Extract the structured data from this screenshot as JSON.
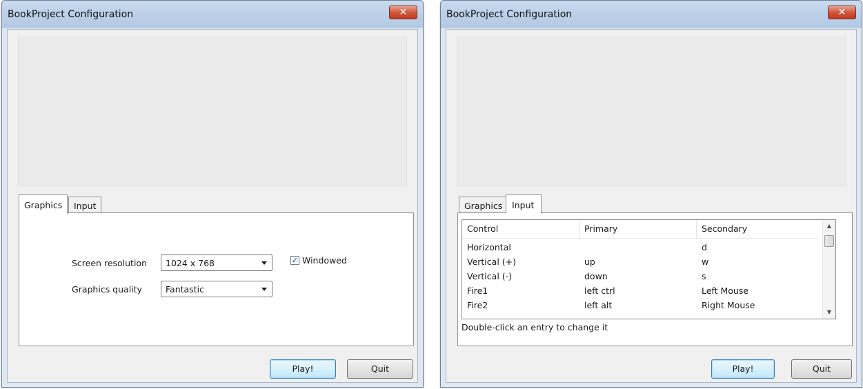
{
  "left_window": {
    "title": "BookProject Configuration",
    "close_glyph": "✕",
    "tabs": [
      "Graphics",
      "Input"
    ],
    "active_tab": "Graphics",
    "screen_resolution_label": "Screen resolution",
    "screen_resolution_value": "1024 x 768",
    "graphics_quality_label": "Graphics quality",
    "graphics_quality_value": "Fantastic",
    "windowed_label": "Windowed",
    "windowed_checked": true,
    "check_glyph": "✓",
    "play_button": "Play!",
    "quit_button": "Quit"
  },
  "right_window": {
    "title": "BookProject Configuration",
    "close_glyph": "✕",
    "tabs": [
      "Graphics",
      "Input"
    ],
    "active_tab": "Input",
    "columns": [
      "Control",
      "Primary",
      "Secondary"
    ],
    "rows": [
      {
        "control": "Horizontal",
        "primary": "",
        "secondary": "d"
      },
      {
        "control": "Vertical (+)",
        "primary": "up",
        "secondary": "w"
      },
      {
        "control": "Vertical (-)",
        "primary": "down",
        "secondary": "s"
      },
      {
        "control": "Fire1",
        "primary": "left ctrl",
        "secondary": "Left Mouse"
      },
      {
        "control": "Fire2",
        "primary": "left alt",
        "secondary": "Right Mouse"
      }
    ],
    "scroll_up_glyph": "▲",
    "scroll_down_glyph": "▼",
    "hint": "Double-click an entry to change it",
    "play_button": "Play!",
    "quit_button": "Quit"
  },
  "colors": {
    "titlebar": "#bcd0e8",
    "close_button": "#d0573c",
    "default_button": "#bee6fd",
    "client_background": "#f0f0f0"
  }
}
